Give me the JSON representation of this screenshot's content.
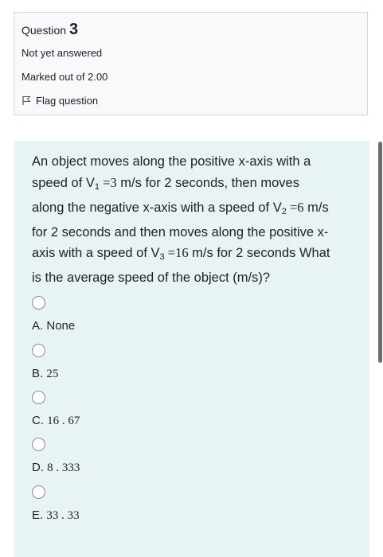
{
  "info": {
    "question_prefix": "Question",
    "question_number": "3",
    "state": "Not yet answered",
    "grade": "Marked out of 2.00",
    "flag_label": "Flag question"
  },
  "question": {
    "line1": "An object moves along the positive x-axis with a",
    "l2_a": "speed of V",
    "l2_sub": "1",
    "l2_b": " =3",
    "l2_c": " m/s for 2 seconds, then moves",
    "line3": "along the negative x-axis with a speed of ",
    "l3_v": "V",
    "l3_sub": "2",
    "l3_val": " =6",
    "l3_unit": " m/s",
    "line4": "for 2 seconds and then moves along the positive x-",
    "l5_a": "axis with a speed of ",
    "l5_v": "V",
    "l5_sub": "3",
    "l5_val": " =16",
    "l5_b": " m/s for 2 seconds What",
    "line6": "is the average speed of the object (m/s)?"
  },
  "options": [
    {
      "letter": "A.",
      "value": "None"
    },
    {
      "letter": "B.",
      "value": "25"
    },
    {
      "letter": "C.",
      "value": "16 . 67"
    },
    {
      "letter": "D.",
      "value": "8 . 333"
    },
    {
      "letter": "E.",
      "value": "33 . 33"
    }
  ],
  "colors": {
    "info_bg": "#f8f9fa",
    "content_bg": "#e7f3f5",
    "text": "#1d2125"
  }
}
